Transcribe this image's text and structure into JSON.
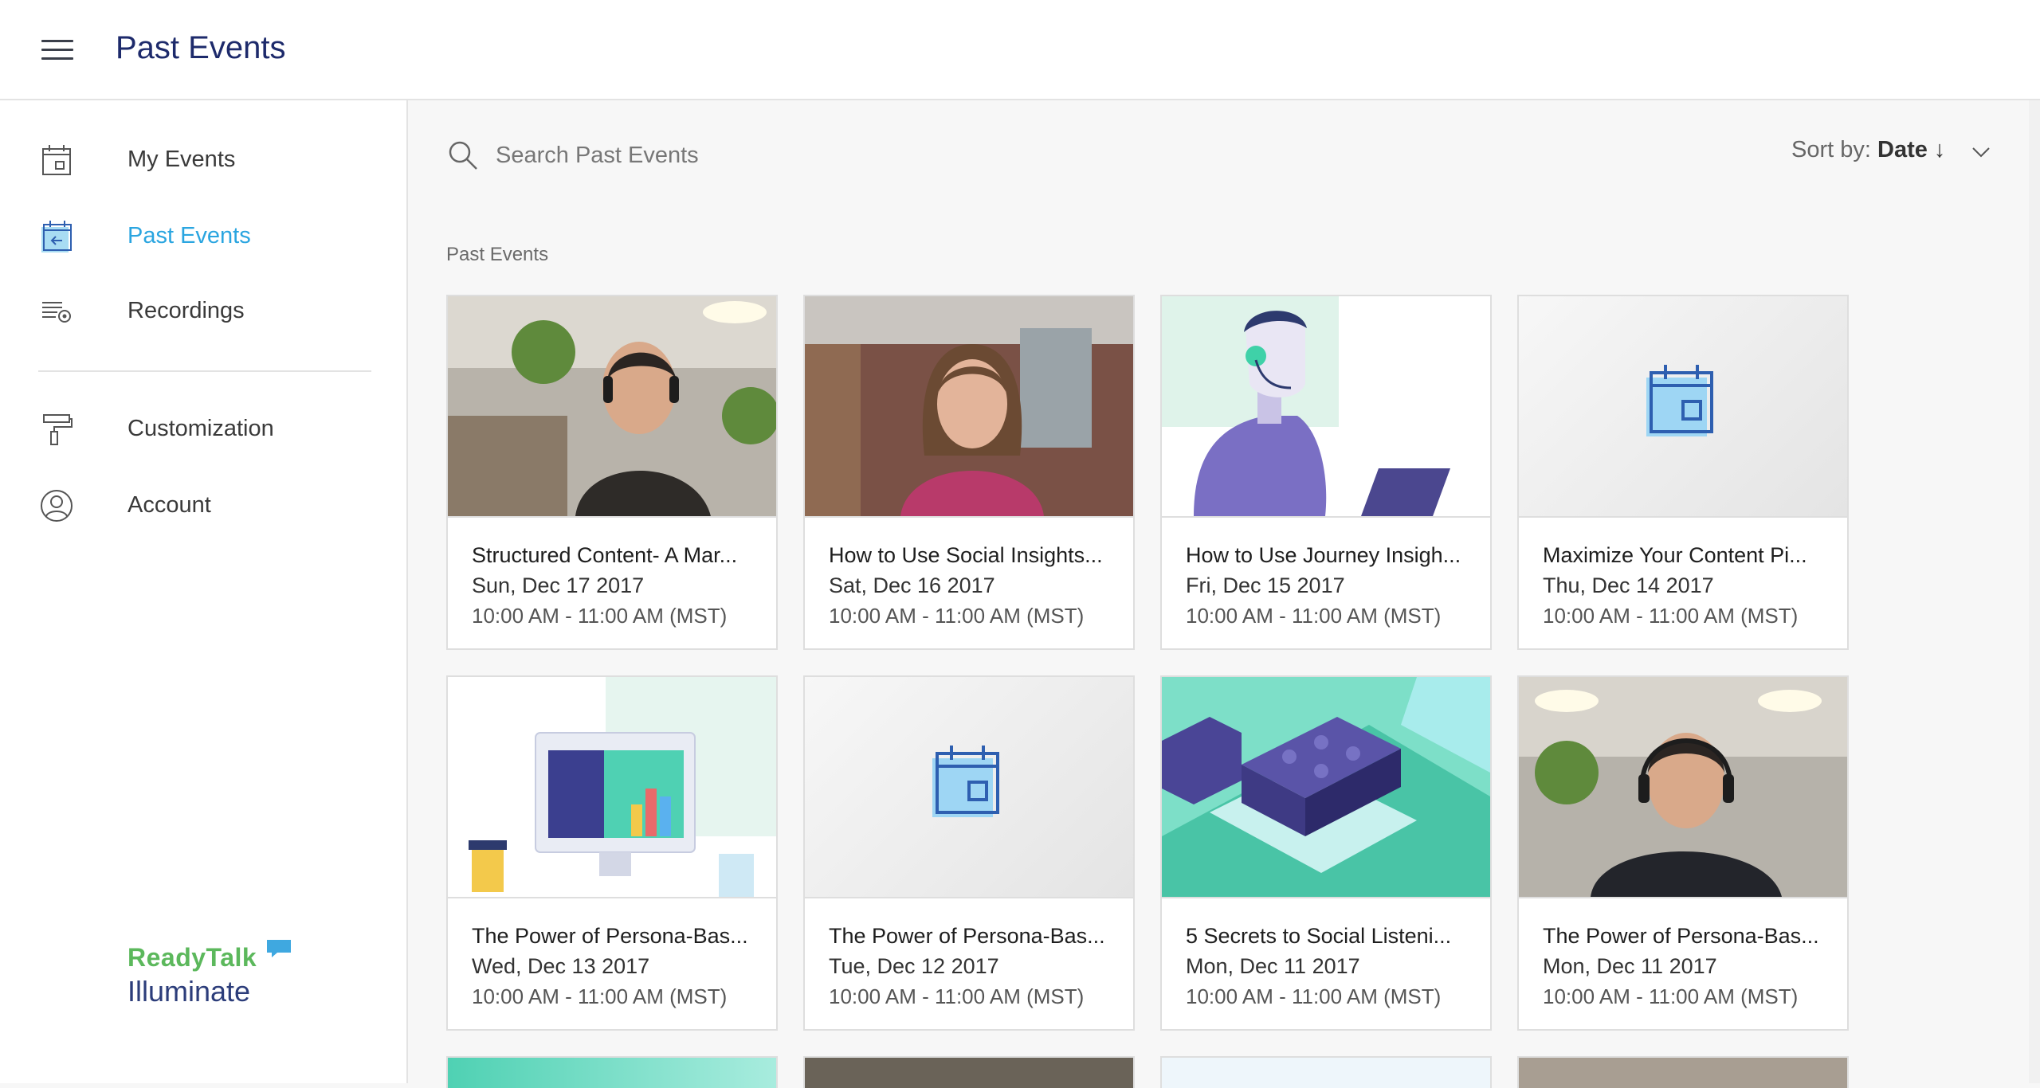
{
  "header": {
    "title": "Past Events",
    "menu_icon": "hamburger-menu-icon"
  },
  "sidebar": {
    "items": [
      {
        "label": "My Events",
        "icon": "calendar-icon",
        "active": false
      },
      {
        "label": "Past Events",
        "icon": "calendar-back-icon",
        "active": true
      },
      {
        "label": "Recordings",
        "icon": "recordings-icon",
        "active": false
      },
      {
        "label": "Customization",
        "icon": "paint-roller-icon",
        "active": false
      },
      {
        "label": "Account",
        "icon": "user-circle-icon",
        "active": false
      }
    ],
    "brand": {
      "line1": "ReadyTalk",
      "line2": "Illuminate"
    }
  },
  "search": {
    "placeholder": "Search Past Events"
  },
  "sort": {
    "label": "Sort by:",
    "value": "Date"
  },
  "section_label": "Past Events",
  "colors": {
    "accent": "#2aa5e0",
    "title": "#1d2a6b",
    "brand_green": "#5cb85c",
    "calendar_blue": "#2e5fb0"
  },
  "events": [
    {
      "title": "Structured Content- A Mar...",
      "date": "Sun, Dec 17 2017",
      "time": "10:00 AM - 11:00 AM (MST)",
      "thumb": "photo-man-headset"
    },
    {
      "title": "How to Use Social Insights...",
      "date": "Sat, Dec 16 2017",
      "time": "10:00 AM - 11:00 AM (MST)",
      "thumb": "photo-woman-office"
    },
    {
      "title": "How to Use Journey Insigh...",
      "date": "Fri, Dec 15 2017",
      "time": "10:00 AM - 11:00 AM (MST)",
      "thumb": "illustration-agent-headset"
    },
    {
      "title": "Maximize Your Content Pi...",
      "date": "Thu, Dec 14 2017",
      "time": "10:00 AM - 11:00 AM (MST)",
      "thumb": "calendar-placeholder"
    },
    {
      "title": "The Power of Persona-Bas...",
      "date": "Wed, Dec 13 2017",
      "time": "10:00 AM - 11:00 AM (MST)",
      "thumb": "illustration-monitor-chart"
    },
    {
      "title": "The Power of Persona-Bas...",
      "date": "Tue, Dec 12 2017",
      "time": "10:00 AM - 11:00 AM (MST)",
      "thumb": "calendar-placeholder"
    },
    {
      "title": "5 Secrets to Social Listeni...",
      "date": "Mon, Dec 11 2017",
      "time": "10:00 AM - 11:00 AM (MST)",
      "thumb": "illustration-blocks"
    },
    {
      "title": "The Power of Persona-Bas...",
      "date": "Mon, Dec 11 2017",
      "time": "10:00 AM - 11:00 AM (MST)",
      "thumb": "photo-man-headset"
    }
  ]
}
